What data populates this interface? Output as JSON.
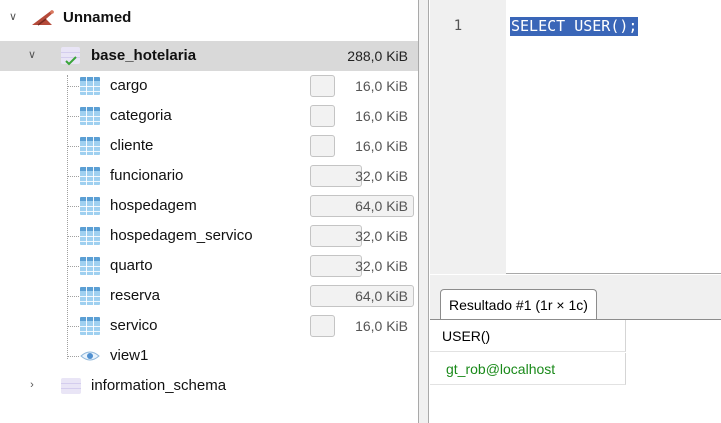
{
  "tree": {
    "connection": {
      "label": "Unnamed"
    },
    "database": {
      "label": "base_hotelaria",
      "size": "288,0 KiB"
    },
    "tables": [
      {
        "label": "cargo",
        "size": "16,0 KiB",
        "fill": 0.25
      },
      {
        "label": "categoria",
        "size": "16,0 KiB",
        "fill": 0.25
      },
      {
        "label": "cliente",
        "size": "16,0 KiB",
        "fill": 0.25
      },
      {
        "label": "funcionario",
        "size": "32,0 KiB",
        "fill": 0.5
      },
      {
        "label": "hospedagem",
        "size": "64,0 KiB",
        "fill": 1.0
      },
      {
        "label": "hospedagem_servico",
        "size": "32,0 KiB",
        "fill": 0.5
      },
      {
        "label": "quarto",
        "size": "32,0 KiB",
        "fill": 0.5
      },
      {
        "label": "reserva",
        "size": "64,0 KiB",
        "fill": 1.0
      },
      {
        "label": "servico",
        "size": "16,0 KiB",
        "fill": 0.25
      }
    ],
    "view": {
      "label": "view1"
    },
    "other_schema": {
      "label": "information_schema"
    }
  },
  "editor": {
    "line_number": "1",
    "code": "SELECT USER();"
  },
  "results": {
    "tab_label": "Resultado #1 (1r × 1c)",
    "column": "USER()",
    "value": "gt_rob@localhost"
  },
  "colors": {
    "selection": "#3a66b8",
    "result_value": "#1a8a1a",
    "selected_row": "#d9d9d9"
  },
  "icons": [
    "chevron-down-icon",
    "chevron-right-icon",
    "connection-icon",
    "database-icon",
    "table-icon",
    "view-icon"
  ]
}
